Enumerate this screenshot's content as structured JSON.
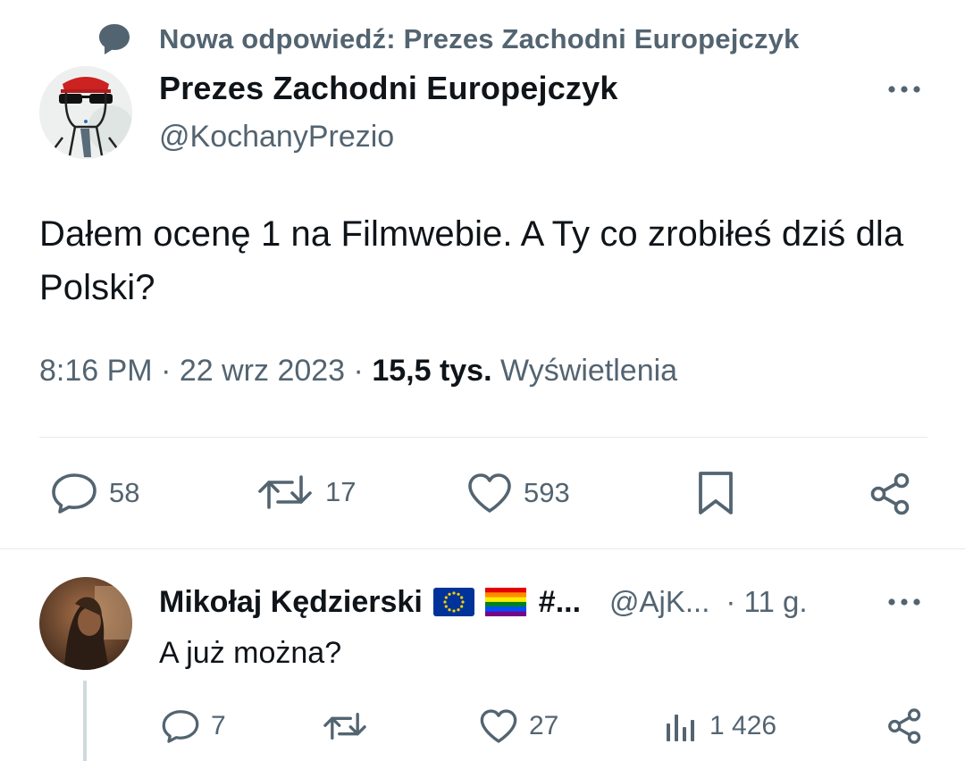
{
  "notice": {
    "icon": "chat-bubble-icon",
    "text": "Nowa odpowiedź: Prezes Zachodni Europejczyk"
  },
  "tweet": {
    "author_name": "Prezes Zachodni Europejczyk",
    "author_handle": "@KochanyPrezio",
    "text": "Dałem ocenę 1 na Filmwebie. A Ty co zrobiłeś dziś dla Polski?",
    "time": "8:16 PM",
    "date": "22 wrz 2023",
    "separator": "·",
    "views_count": "15,5 tys.",
    "views_label": "Wyświetlenia",
    "actions": {
      "replies": "58",
      "retweets": "17",
      "likes": "593"
    }
  },
  "reply": {
    "author_name": "Mikołaj Kędzierski",
    "name_trail": "#...",
    "author_handle": "@AjK...",
    "age": "· 11 g.",
    "text": "A już można?",
    "actions": {
      "replies": "7",
      "retweets": "",
      "likes": "27",
      "views": "1 426"
    }
  },
  "colors": {
    "text": "#0f1419",
    "secondary": "#536471",
    "divider": "#e7e9ea",
    "thread_line": "#cfd9de",
    "eu_flag_blue": "#003399",
    "eu_flag_stars": "#ffcc00"
  }
}
